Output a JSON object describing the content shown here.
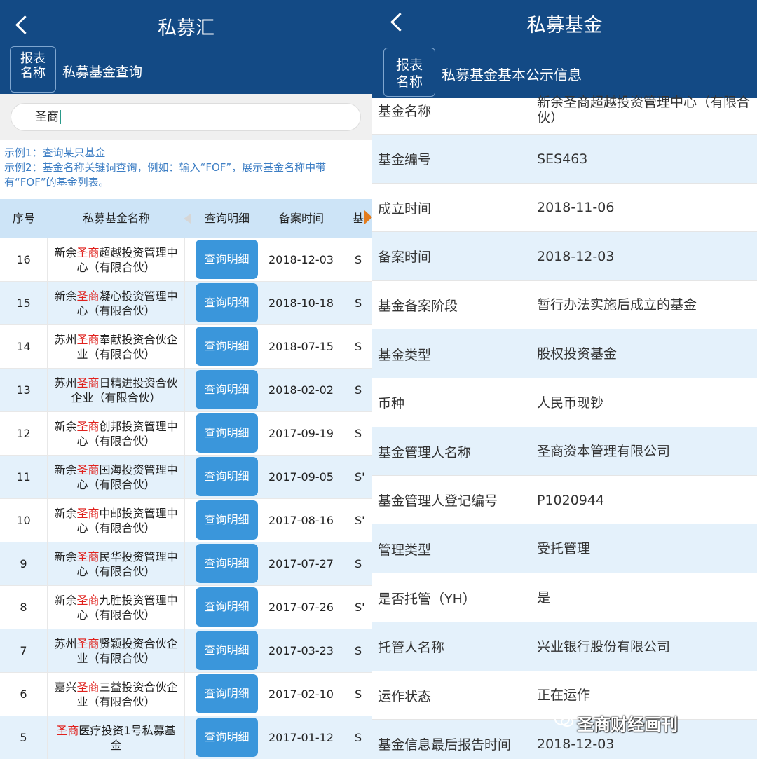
{
  "left": {
    "title": "私募汇",
    "report_btn": [
      "报表",
      "名称"
    ],
    "subtitle": "私募基金查询",
    "search_value": "圣商",
    "hints": [
      "示例1：查询某只基金",
      "示例2：基金名称关键词查询，例如：输入“FOF”，展示基金名称中带有“FOF”的基金列表。"
    ],
    "columns": [
      "序号",
      "私募基金名称",
      "查询明细",
      "备案时间",
      "基"
    ],
    "detail_label": "查询明细",
    "rows": [
      {
        "idx": "16",
        "pre": "新余",
        "hl": "圣商",
        "post": "超越投资管理中心（有限合伙）",
        "date": "2018-12-03",
        "code": "S"
      },
      {
        "idx": "15",
        "pre": "新余",
        "hl": "圣商",
        "post": "凝心投资管理中心（有限合伙）",
        "date": "2018-10-18",
        "code": "S"
      },
      {
        "idx": "14",
        "pre": "苏州",
        "hl": "圣商",
        "post": "奉献投资合伙企业（有限合伙）",
        "date": "2018-07-15",
        "code": "S"
      },
      {
        "idx": "13",
        "pre": "苏州",
        "hl": "圣商",
        "post": "日精进投资合伙企业（有限合伙）",
        "date": "2018-02-02",
        "code": "S"
      },
      {
        "idx": "12",
        "pre": "新余",
        "hl": "圣商",
        "post": "创邦投资管理中心（有限合伙）",
        "date": "2017-09-19",
        "code": "S"
      },
      {
        "idx": "11",
        "pre": "新余",
        "hl": "圣商",
        "post": "国海投资管理中心（有限合伙）",
        "date": "2017-09-05",
        "code": "S'"
      },
      {
        "idx": "10",
        "pre": "新余",
        "hl": "圣商",
        "post": "中邮投资管理中心（有限合伙）",
        "date": "2017-08-16",
        "code": "S'"
      },
      {
        "idx": "9",
        "pre": "新余",
        "hl": "圣商",
        "post": "民华投资管理中心（有限合伙）",
        "date": "2017-07-27",
        "code": "S"
      },
      {
        "idx": "8",
        "pre": "新余",
        "hl": "圣商",
        "post": "九胜投资管理中心（有限合伙）",
        "date": "2017-07-26",
        "code": "S'"
      },
      {
        "idx": "7",
        "pre": "苏州",
        "hl": "圣商",
        "post": "贤颖投资合伙企业（有限合伙）",
        "date": "2017-03-23",
        "code": "S"
      },
      {
        "idx": "6",
        "pre": "嘉兴",
        "hl": "圣商",
        "post": "三益投资合伙企业（有限合伙）",
        "date": "2017-02-10",
        "code": "S"
      },
      {
        "idx": "5",
        "pre": "",
        "hl": "圣商",
        "post": "医疗投资1号私募基金",
        "date": "2017-01-12",
        "code": "S"
      }
    ]
  },
  "right": {
    "title": "私募基金",
    "report_btn": [
      "报表",
      "名称"
    ],
    "subtitle": "私募基金基本公示信息",
    "rows": [
      {
        "label": "基金名称",
        "value": "新余圣商超越投资管理中心（有限合伙）"
      },
      {
        "label": "基金编号",
        "value": "SES463"
      },
      {
        "label": "成立时间",
        "value": "2018-11-06"
      },
      {
        "label": "备案时间",
        "value": "2018-12-03"
      },
      {
        "label": "基金备案阶段",
        "value": "暂行办法实施后成立的基金"
      },
      {
        "label": "基金类型",
        "value": "股权投资基金"
      },
      {
        "label": "币种",
        "value": "人民币现钞"
      },
      {
        "label": "基金管理人名称",
        "value": "圣商资本管理有限公司"
      },
      {
        "label": "基金管理人登记编号",
        "value": "P1020944"
      },
      {
        "label": "管理类型",
        "value": "受托管理"
      },
      {
        "label": "是否托管（YH）",
        "value": "是"
      },
      {
        "label": "托管人名称",
        "value": "兴业银行股份有限公司"
      },
      {
        "label": "运作状态",
        "value": "正在运作"
      },
      {
        "label": "基金信息最后报告时间",
        "value": "2018-12-03"
      }
    ]
  },
  "watermark": "圣商财经画刊"
}
